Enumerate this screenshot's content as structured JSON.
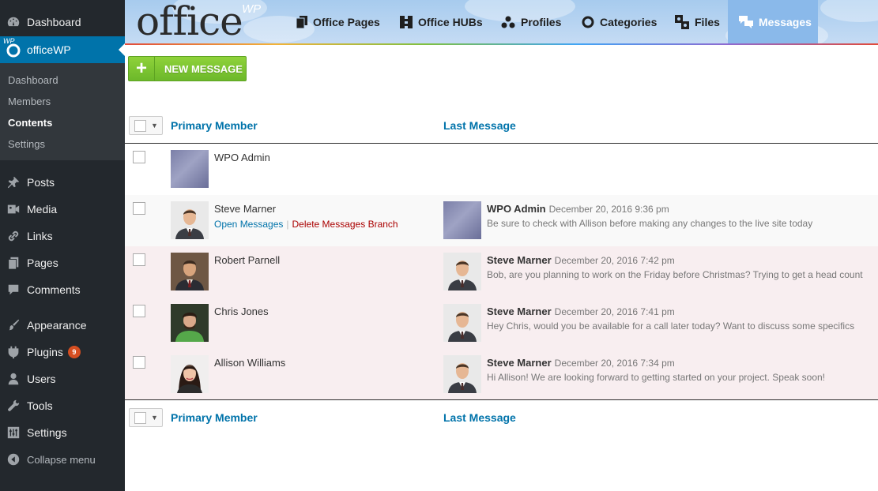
{
  "sidebar": {
    "top_items": [
      {
        "label": "Dashboard",
        "icon": "dashboard-icon"
      },
      {
        "label": "officeWP",
        "icon": "officewp-icon",
        "icon_badge": "WP",
        "active": true
      }
    ],
    "submenu": [
      {
        "label": "Dashboard"
      },
      {
        "label": "Members"
      },
      {
        "label": "Contents",
        "current": true
      },
      {
        "label": "Settings"
      }
    ],
    "items": [
      {
        "label": "Posts",
        "icon": "pin-icon"
      },
      {
        "label": "Media",
        "icon": "media-icon"
      },
      {
        "label": "Links",
        "icon": "link-icon"
      },
      {
        "label": "Pages",
        "icon": "pages-icon"
      },
      {
        "label": "Comments",
        "icon": "comment-icon"
      },
      {
        "label": "Appearance",
        "icon": "brush-icon"
      },
      {
        "label": "Plugins",
        "icon": "plugin-icon",
        "badge": "9"
      },
      {
        "label": "Users",
        "icon": "users-icon"
      },
      {
        "label": "Tools",
        "icon": "wrench-icon"
      },
      {
        "label": "Settings",
        "icon": "settings-icon"
      },
      {
        "label": "Collapse menu",
        "icon": "collapse-icon"
      }
    ]
  },
  "header": {
    "logo_text": "office",
    "logo_sup": "WP",
    "tabs": [
      {
        "label": "Office Pages",
        "icon": "pages-icon"
      },
      {
        "label": "Office HUBs",
        "icon": "hub-icon"
      },
      {
        "label": "Profiles",
        "icon": "profiles-icon"
      },
      {
        "label": "Categories",
        "icon": "circle-icon"
      },
      {
        "label": "Files",
        "icon": "files-icon"
      },
      {
        "label": "Messages",
        "icon": "messages-icon",
        "active": true
      }
    ]
  },
  "toolbar": {
    "new_message_plus": "+",
    "new_message_label": "NEW MESSAGE"
  },
  "table": {
    "col_primary": "Primary Member",
    "col_last": "Last Message",
    "row_actions": {
      "open": "Open Messages",
      "separator": "|",
      "delete": "Delete Messages Branch"
    },
    "rows": [
      {
        "member": "WPO Admin",
        "avatar": "admin-avatar",
        "last_author": "",
        "last_date": "",
        "last_text": ""
      },
      {
        "member": "Steve Marner",
        "avatar": "steve-avatar",
        "last_author": "WPO Admin",
        "last_date": "December 20, 2016 9:36 pm",
        "last_text": "Be sure to check with Allison before making any changes to the live site today",
        "last_avatar": "admin-avatar"
      },
      {
        "member": "Robert Parnell",
        "avatar": "robert-avatar",
        "last_author": "Steve Marner",
        "last_date": "December 20, 2016 7:42 pm",
        "last_text": "Bob, are you planning to work on the Friday before Christmas? Trying to get a head count",
        "last_avatar": "steve-avatar"
      },
      {
        "member": "Chris Jones",
        "avatar": "chris-avatar",
        "last_author": "Steve Marner",
        "last_date": "December 20, 2016 7:41 pm",
        "last_text": "Hey Chris, would you be available for a call later today? Want to discuss some specifics",
        "last_avatar": "steve-avatar"
      },
      {
        "member": "Allison Williams",
        "avatar": "allison-avatar",
        "last_author": "Steve Marner",
        "last_date": "December 20, 2016 7:34 pm",
        "last_text": "Hi Allison! We are looking forward to getting started on your project. Speak soon!",
        "last_avatar": "steve-avatar"
      }
    ]
  },
  "colors": {
    "sidebar_bg": "#23282d",
    "active_blue": "#0073aa",
    "button_green": "#7cc531",
    "row_pink": "#f8eef0"
  }
}
